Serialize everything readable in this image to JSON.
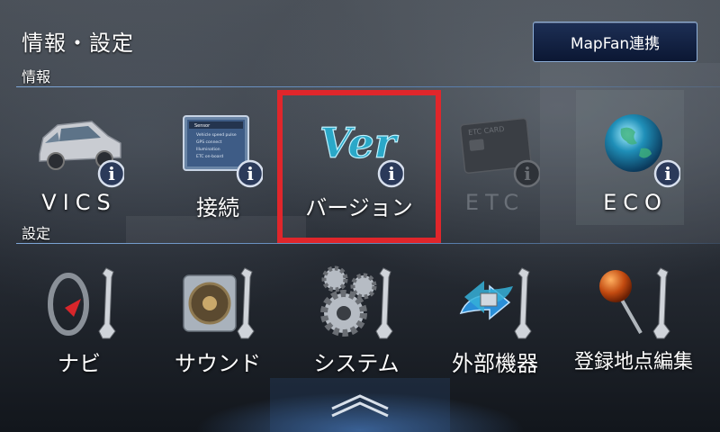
{
  "header": {
    "title": "情報・設定",
    "mapfan_button": "MapFan連携"
  },
  "sections": {
    "info_label": "情報",
    "settings_label": "設定"
  },
  "info_items": [
    {
      "label": "VICS",
      "icon": "car-info-icon",
      "enabled": true
    },
    {
      "label": "接続",
      "icon": "connection-screen-info-icon",
      "enabled": true
    },
    {
      "label": "バージョン",
      "icon": "ver-info-icon",
      "enabled": true,
      "selected": true
    },
    {
      "label": "ETC",
      "icon": "etc-card-info-icon",
      "enabled": false
    },
    {
      "label": "ECO",
      "icon": "globe-info-icon",
      "enabled": true
    }
  ],
  "settings_items": [
    {
      "label": "ナビ",
      "icon": "navi-wrench-icon"
    },
    {
      "label": "サウンド",
      "icon": "speaker-wrench-icon"
    },
    {
      "label": "システム",
      "icon": "gears-wrench-icon"
    },
    {
      "label": "外部機器",
      "icon": "device-wrench-icon"
    },
    {
      "label": "登録地点編集",
      "icon": "pin-wrench-icon"
    }
  ],
  "connect_screen_lines": [
    "Sensor",
    "Vehicle speed pulse",
    "GPS connect",
    "Illumination",
    "ETC on-board"
  ],
  "ver_icon_text": "Ver",
  "etc_card_text": "ETC CARD",
  "colors": {
    "accent_red": "#e0262b",
    "button_blue": "#1d2f55",
    "info_badge": "#2b3a5a",
    "section_line": "#7ea6d6"
  }
}
